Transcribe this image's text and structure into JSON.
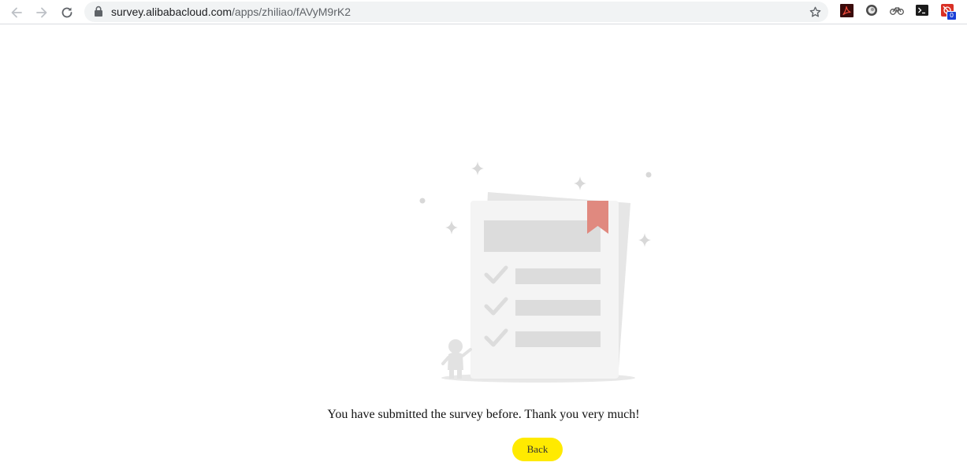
{
  "browser": {
    "url_domain": "survey.alibabacloud.com",
    "url_path": "/apps/zhiliao/fAVyM9rK2",
    "icons": [
      "back-arrow-icon",
      "forward-arrow-icon",
      "reload-icon",
      "lock-icon",
      "bookmark-star-icon"
    ],
    "extensions": [
      "adobe-acrobat-icon",
      "circle-extension-icon",
      "bike-extension-icon",
      "terminal-extension-icon",
      "red-extension-icon"
    ],
    "extension_badge": "0"
  },
  "page": {
    "message": "You have submitted the survey before. Thank you very much!",
    "back_label": "Back",
    "accent_color": "#ffea00"
  }
}
